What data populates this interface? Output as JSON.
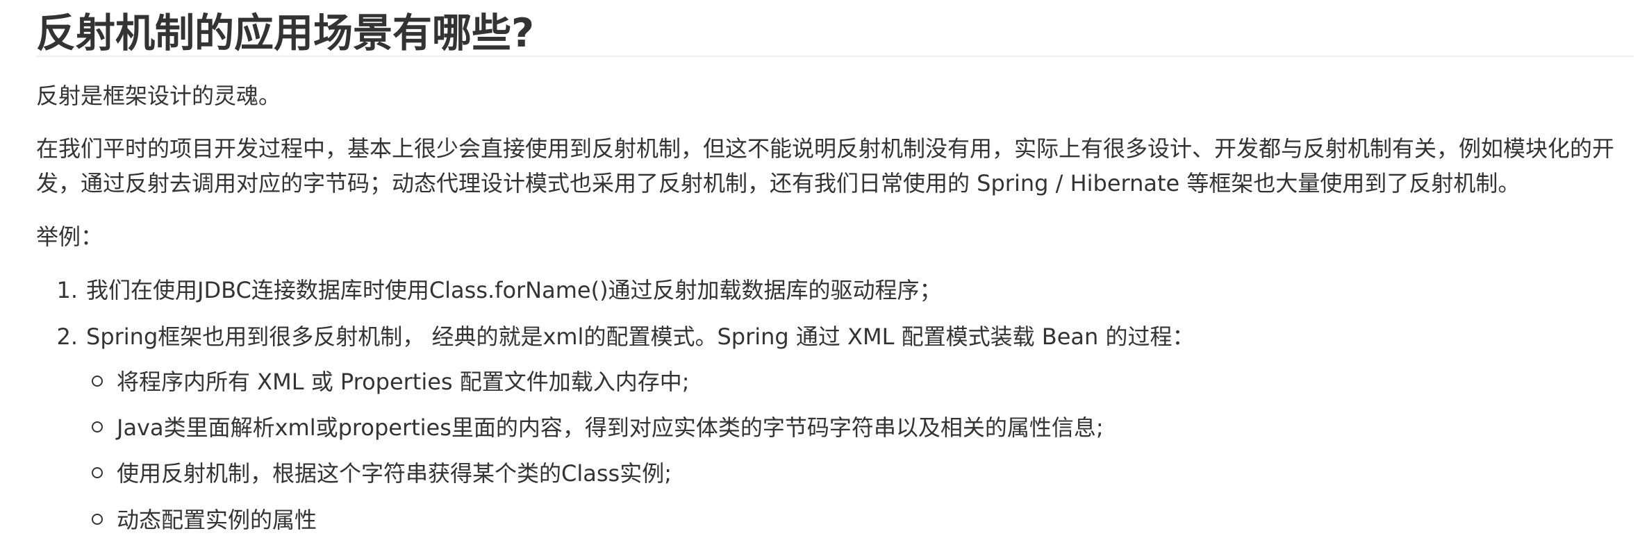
{
  "heading": "反射机制的应用场景有哪些?",
  "intro": "反射是框架设计的灵魂。",
  "description": "在我们平时的项目开发过程中，基本上很少会直接使用到反射机制，但这不能说明反射机制没有用，实际上有很多设计、开发都与反射机制有关，例如模块化的开发，通过反射去调用对应的字节码；动态代理设计模式也采用了反射机制，还有我们日常使用的 Spring / Hibernate 等框架也大量使用到了反射机制。",
  "example_label": "举例：",
  "examples": [
    {
      "number": "1.",
      "text": "我们在使用JDBC连接数据库时使用Class.forName()通过反射加载数据库的驱动程序；"
    },
    {
      "number": "2.",
      "text": "Spring框架也用到很多反射机制， 经典的就是xml的配置模式。Spring 通过 XML 配置模式装载 Bean 的过程："
    }
  ],
  "steps": [
    "将程序内所有 XML 或 Properties 配置文件加载入内存中;",
    "Java类里面解析xml或properties里面的内容，得到对应实体类的字节码字符串以及相关的属性信息;",
    "使用反射机制，根据这个字符串获得某个类的Class实例;",
    "动态配置实例的属性"
  ]
}
